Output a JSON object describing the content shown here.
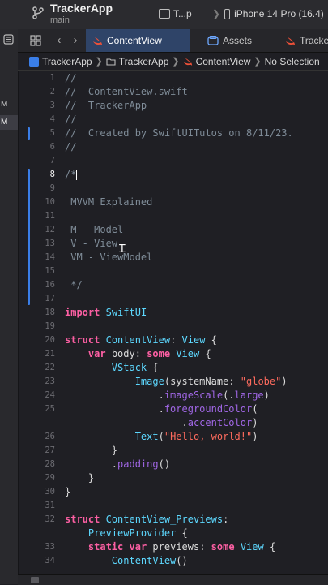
{
  "window": {
    "app_title": "TrackerApp",
    "app_subtitle": "main",
    "scheme_label": "T...p",
    "device_label": "iPhone 14 Pro (16.4)",
    "device_extra": "Pro"
  },
  "sidebar": {
    "items": [
      {
        "label": "M"
      },
      {
        "label": "M"
      }
    ]
  },
  "tabs": [
    {
      "label": "ContentView",
      "icon": "swift-icon",
      "active": true
    },
    {
      "label": "Assets",
      "icon": "assets-icon",
      "active": false
    },
    {
      "label": "Tracke",
      "icon": "swift-icon",
      "active": false
    }
  ],
  "breadcrumb": {
    "project": "TrackerApp",
    "folder": "TrackerApp",
    "file": "ContentView",
    "selection": "No Selection"
  },
  "editor": {
    "lines": [
      {
        "n": "1",
        "text": "//"
      },
      {
        "n": "2",
        "text": "//  ContentView.swift"
      },
      {
        "n": "3",
        "text": "//  TrackerApp"
      },
      {
        "n": "4",
        "text": "//"
      },
      {
        "n": "5",
        "text": "//  Created by SwiftUITutos on 8/11/23."
      },
      {
        "n": "6",
        "text": "//"
      },
      {
        "n": "7",
        "text": ""
      },
      {
        "n": "8",
        "text": "/*"
      },
      {
        "n": "9",
        "text": ""
      },
      {
        "n": "10",
        "text": " MVVM Explained"
      },
      {
        "n": "11",
        "text": ""
      },
      {
        "n": "12",
        "text": " M - Model"
      },
      {
        "n": "13",
        "text": " V - View"
      },
      {
        "n": "14",
        "text": " VM - ViewModel"
      },
      {
        "n": "15",
        "text": ""
      },
      {
        "n": "16",
        "text": " */"
      },
      {
        "n": "17",
        "text": ""
      },
      {
        "n": "18",
        "text": "import SwiftUI"
      },
      {
        "n": "19",
        "text": ""
      },
      {
        "n": "20",
        "text": "struct ContentView: View {"
      },
      {
        "n": "21",
        "text": "    var body: some View {"
      },
      {
        "n": "22",
        "text": "        VStack {"
      },
      {
        "n": "23",
        "text": "            Image(systemName: \"globe\")"
      },
      {
        "n": "24",
        "text": "                .imageScale(.large)"
      },
      {
        "n": "25",
        "text": "                .foregroundColor("
      },
      {
        "n": "",
        "text": "                    .accentColor)"
      },
      {
        "n": "26",
        "text": "            Text(\"Hello, world!\")"
      },
      {
        "n": "27",
        "text": "        }"
      },
      {
        "n": "28",
        "text": "        .padding()"
      },
      {
        "n": "29",
        "text": "    }"
      },
      {
        "n": "30",
        "text": "}"
      },
      {
        "n": "31",
        "text": ""
      },
      {
        "n": "32",
        "text": "struct ContentView_Previews:"
      },
      {
        "n": "",
        "text": "    PreviewProvider {"
      },
      {
        "n": "33",
        "text": "    static var previews: some View {"
      },
      {
        "n": "34",
        "text": "        ContentView()"
      }
    ],
    "current_line": "8"
  },
  "colors": {
    "background": "#1f1f24",
    "keyword": "#fc5fa3",
    "type": "#5dd8ff",
    "string": "#fc6a5d",
    "comment": "#7f8c98",
    "member": "#a167e6",
    "accent_tab": "#2f4468",
    "change_marker": "#3a7ee8"
  }
}
